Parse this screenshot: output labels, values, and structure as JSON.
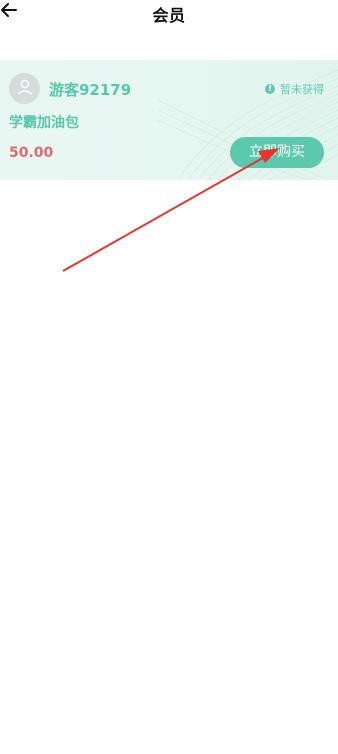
{
  "header": {
    "title": "会员",
    "back_icon": "arrow-left-icon"
  },
  "card": {
    "avatar_icon": "user-avatar-icon",
    "username": "游客92179",
    "status_icon": "info-icon",
    "status_text": "暂未获得",
    "plan_name": "学霸加油包",
    "price": "50.00",
    "buy_label": "立即购买"
  },
  "colors": {
    "accent": "#5cc8ac",
    "card_bg": "#e6f6f1",
    "price": "#e46a6a",
    "annotation": "#e8342a"
  }
}
